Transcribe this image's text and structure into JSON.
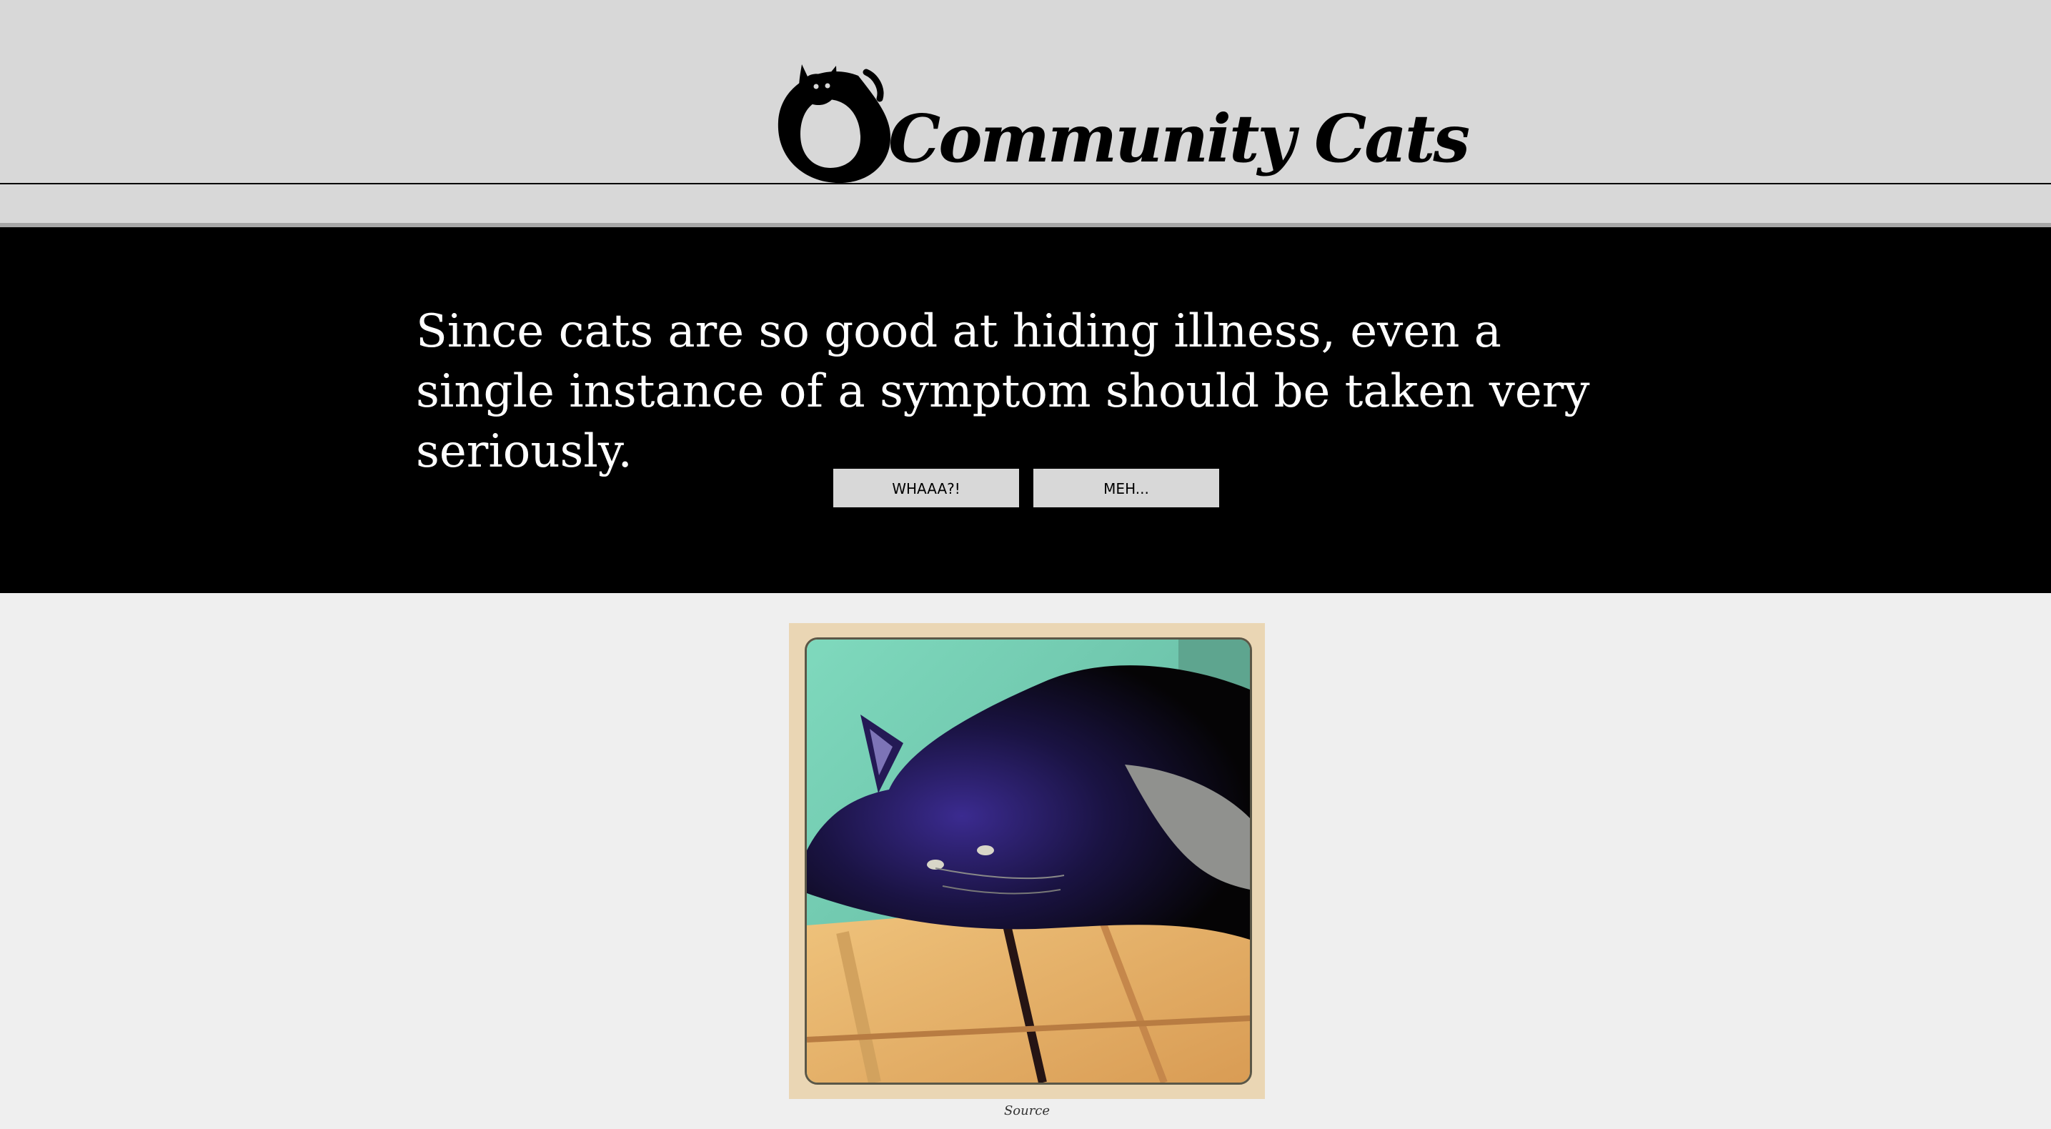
{
  "header": {
    "logo_text": "Community Cats",
    "logo_icon": "cat-c-logo-icon"
  },
  "hero": {
    "fact_text": "Since cats are so good at hiding illness, even a single instance of a symptom should be taken very seriously.",
    "buttons": [
      {
        "label": "WHAAA?!"
      },
      {
        "label": "MEH..."
      }
    ]
  },
  "content": {
    "image_subject": "black cat lying on wooden shelf",
    "source_label": "Source"
  },
  "colors": {
    "header_bg": "#d8d8d8",
    "hero_bg": "#000000",
    "page_bg": "#efefef",
    "button_bg": "#d8d8d8",
    "fact_text": "#ffffff"
  }
}
